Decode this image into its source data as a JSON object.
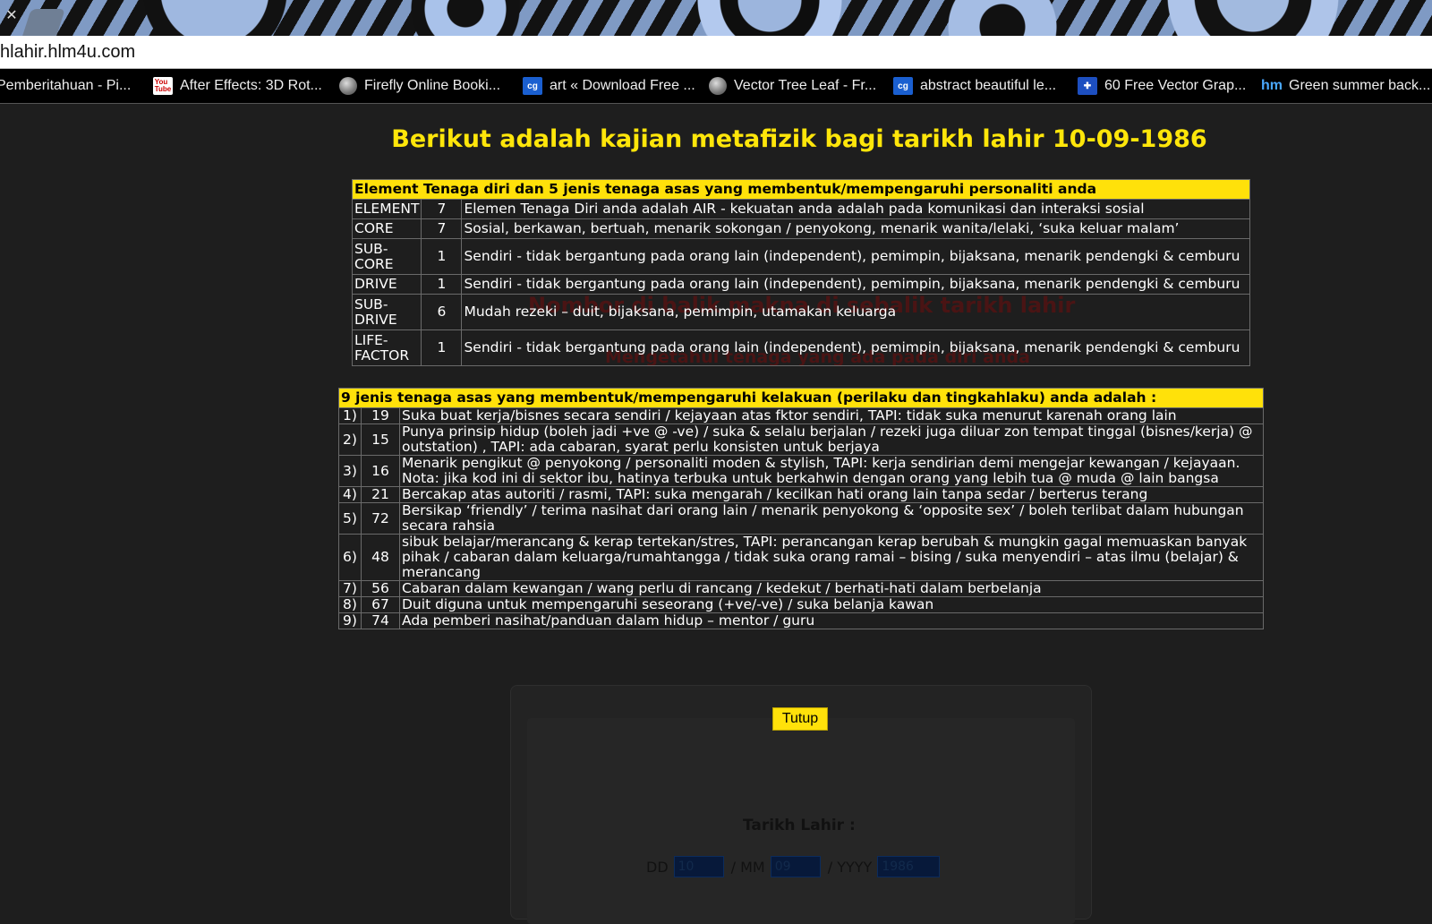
{
  "browser": {
    "url": "hlahir.hlm4u.com",
    "bookmarks": [
      {
        "label": "Pemberitahuan - Pi...",
        "icon": "none"
      },
      {
        "label": "After Effects: 3D Rot...",
        "icon": "youtube-icon"
      },
      {
        "label": "Firefly Online Booki...",
        "icon": "globe-icon"
      },
      {
        "label": "art « Download Free ...",
        "icon": "cg-icon"
      },
      {
        "label": "Vector Tree Leaf - Fr...",
        "icon": "globe-icon"
      },
      {
        "label": "abstract beautiful le...",
        "icon": "cg-icon"
      },
      {
        "label": "60 Free Vector Grap...",
        "icon": "plus-icon"
      },
      {
        "label": "Green summer back...",
        "icon": "hm-icon"
      }
    ]
  },
  "page": {
    "title": "Berikut adalah kajian metafizik bagi tarikh lahir 10-09-1986",
    "ghost_line1": "Nombor di balik makna di sebalik tarikh lahir",
    "ghost_line2": "Mengetahui tenaga yang ada pada diri anda"
  },
  "table1": {
    "header": "Element Tenaga diri dan 5 jenis tenaga asas yang membentuk/mempengaruhi personaliti anda",
    "rows": [
      {
        "label": "ELEMENT",
        "num": "7",
        "desc": "Elemen Tenaga Diri anda adalah AIR - kekuatan anda adalah pada komunikasi dan interaksi sosial"
      },
      {
        "label": "CORE",
        "num": "7",
        "desc": "Sosial, berkawan, bertuah, menarik sokongan / penyokong, menarik wanita/lelaki, ‘suka keluar malam’"
      },
      {
        "label": "SUB-CORE",
        "num": "1",
        "desc": "Sendiri - tidak bergantung pada orang lain (independent), pemimpin, bijaksana, menarik pendengki & cemburu"
      },
      {
        "label": "DRIVE",
        "num": "1",
        "desc": "Sendiri - tidak bergantung pada orang lain (independent), pemimpin, bijaksana, menarik pendengki & cemburu"
      },
      {
        "label": "SUB-DRIVE",
        "num": "6",
        "desc": "Mudah rezeki – duit, bijaksana, pemimpin, utamakan keluarga"
      },
      {
        "label": "LIFE-FACTOR",
        "num": "1",
        "desc": "Sendiri - tidak bergantung pada orang lain (independent), pemimpin, bijaksana, menarik pendengki & cemburu"
      }
    ]
  },
  "table2": {
    "header": "9 jenis tenaga asas yang membentuk/mempengaruhi kelakuan (perilaku dan tingkahlaku) anda adalah :",
    "rows": [
      {
        "idx": "1)",
        "num": "19",
        "desc": "Suka buat kerja/bisnes secara sendiri / kejayaan atas fktor sendiri, TAPI: tidak suka menurut karenah orang lain"
      },
      {
        "idx": "2)",
        "num": "15",
        "desc": "Punya prinsip hidup (boleh jadi +ve @ -ve) / suka & selalu berjalan / rezeki juga diluar zon tempat tinggal (bisnes/kerja) @ outstation) , TAPI: ada cabaran, syarat perlu konsisten untuk berjaya"
      },
      {
        "idx": "3)",
        "num": "16",
        "desc": "Menarik pengikut @ penyokong / personaliti moden & stylish, TAPI: kerja sendirian demi mengejar kewangan / kejayaan. Nota: jika kod ini di sektor ibu, hatinya terbuka untuk berkahwin dengan orang yang lebih tua @ muda @ lain bangsa"
      },
      {
        "idx": "4)",
        "num": "21",
        "desc": "Bercakap atas autoriti / rasmi, TAPI: suka mengarah / kecilkan hati orang lain tanpa sedar / berterus terang"
      },
      {
        "idx": "5)",
        "num": "72",
        "desc": "Bersikap ‘friendly’ / terima nasihat dari orang lain / menarik penyokong & ‘opposite sex’ / boleh terlibat dalam hubungan secara rahsia"
      },
      {
        "idx": "6)",
        "num": "48",
        "desc": "sibuk belajar/merancang & kerap tertekan/stres, TAPI: perancangan kerap berubah & mungkin gagal memuaskan banyak pihak / cabaran dalam keluarga/rumahtangga / tidak suka orang ramai – bising / suka menyendiri – atas ilmu (belajar) & merancang"
      },
      {
        "idx": "7)",
        "num": "56",
        "desc": "Cabaran dalam kewangan / wang perlu di rancang / kedekut / berhati-hati dalam berbelanja"
      },
      {
        "idx": "8)",
        "num": "67",
        "desc": "Duit diguna untuk mempengaruhi seseorang (+ve/-ve) / suka belanja kawan"
      },
      {
        "idx": "9)",
        "num": "74",
        "desc": "Ada pemberi nasihat/panduan dalam hidup – mentor / guru"
      }
    ]
  },
  "form": {
    "close_label": "Tutup",
    "dob_label": "Tarikh Lahir :",
    "dd_label": "DD",
    "mm_label": "/ MM",
    "yyyy_label": "/ YYYY",
    "dd_value": "10",
    "mm_value": "09",
    "yyyy_value": "1986"
  },
  "colors": {
    "accent_yellow": "#ffe10a",
    "page_bg": "#1e1e1e"
  }
}
